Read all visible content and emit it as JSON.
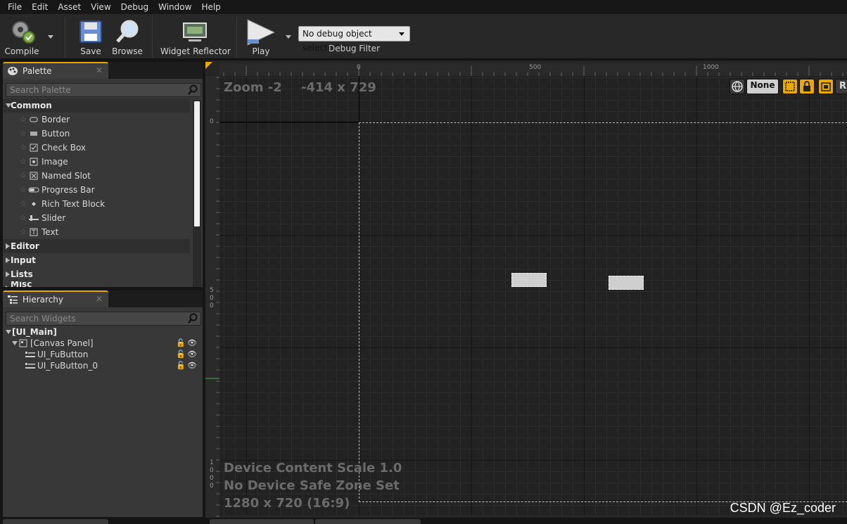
{
  "menu": [
    "File",
    "Edit",
    "Asset",
    "View",
    "Debug",
    "Window",
    "Help"
  ],
  "toolbar": {
    "compile_label": "Compile",
    "save_label": "Save",
    "browse_label": "Browse",
    "widget_reflector_label": "Widget Reflector",
    "play_label": "Play",
    "debug_select_value": "No debug object selected",
    "debug_filter_label": "Debug Filter"
  },
  "palette": {
    "tab_label": "Palette",
    "search_placeholder": "Search Palette",
    "categories": {
      "common": "Common",
      "editor": "Editor",
      "input": "Input",
      "lists": "Lists",
      "misc": "Misc"
    },
    "common_items": [
      "Border",
      "Button",
      "Check Box",
      "Image",
      "Named Slot",
      "Progress Bar",
      "Rich Text Block",
      "Slider",
      "Text"
    ]
  },
  "hierarchy": {
    "tab_label": "Hierarchy",
    "search_placeholder": "Search Widgets",
    "root": "[UI_Main]",
    "canvas": "[Canvas Panel]",
    "children": [
      "UI_FuButton",
      "UI_FuButton_0"
    ]
  },
  "designer": {
    "zoom": "Zoom -2",
    "coords": "-414 x 729",
    "scale": "Device Content Scale 1.0",
    "safe_zone": "No Device Safe Zone Set",
    "resolution": "1280 x 720 (16:9)",
    "ruler_top": [
      "0",
      "500",
      "1000"
    ],
    "ruler_left": [
      "0",
      "5\n0\n0",
      "1\n0\n0\n0"
    ],
    "tool_none": "None",
    "tool_r": "R"
  },
  "watermark": "CSDN @Ez_coder",
  "colors": {
    "accent": "#e8a800",
    "panel": "#383838",
    "canvas": "#222222"
  }
}
